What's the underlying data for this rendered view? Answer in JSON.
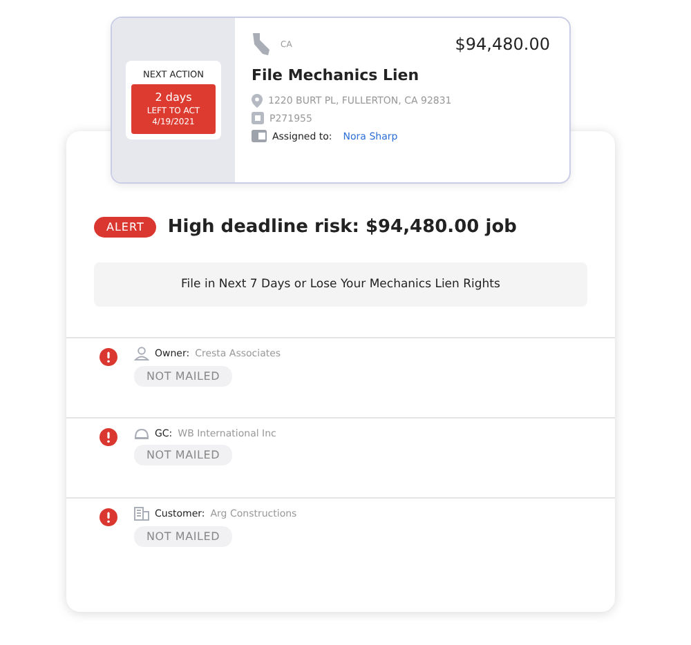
{
  "job_card": {
    "next_action_label": "NEXT ACTION",
    "days": "2 days",
    "left_to_act": "LEFT TO ACT",
    "due_date": "4/19/2021",
    "state": "CA",
    "amount": "$94,480.00",
    "title": "File Mechanics Lien",
    "address": "1220 BURT PL, FULLERTON, CA 92831",
    "project_id": "P271955",
    "assigned_label": "Assigned to:",
    "assignee": "Nora Sharp"
  },
  "alert": {
    "badge": "ALERT",
    "headline": "High deadline risk: $94,480.00 job",
    "notice": "File in Next 7 Days or Lose Your Mechanics Lien Rights"
  },
  "parties": [
    {
      "kind": "owner",
      "role": "Owner:",
      "name": "Cresta Associates",
      "status": "NOT MAILED"
    },
    {
      "kind": "gc",
      "role": "GC:",
      "name": "WB International Inc",
      "status": "NOT MAILED"
    },
    {
      "kind": "customer",
      "role": "Customer:",
      "name": "Arg Constructions",
      "status": "NOT MAILED"
    }
  ]
}
